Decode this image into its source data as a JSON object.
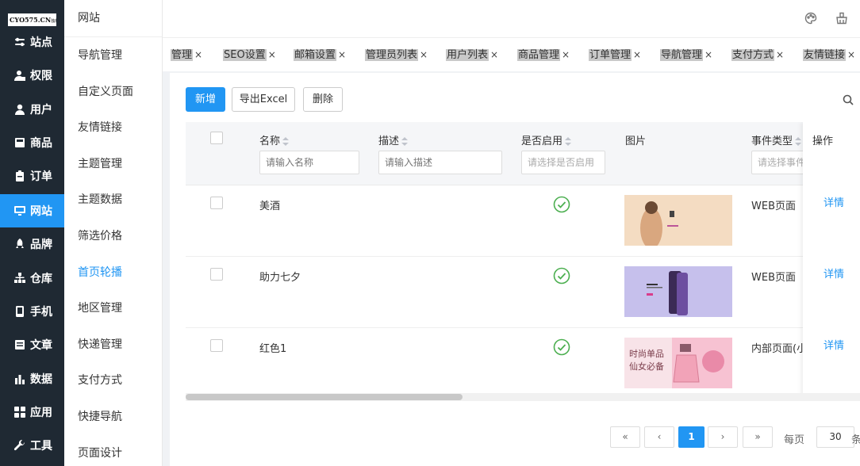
{
  "logo": {
    "text": "CYO575.CN",
    "sub": "独推"
  },
  "sidebar": {
    "items": [
      {
        "label": "站点",
        "icon": "sliders-icon"
      },
      {
        "label": "权限",
        "icon": "user-lock-icon"
      },
      {
        "label": "用户",
        "icon": "user-icon"
      },
      {
        "label": "商品",
        "icon": "box-icon"
      },
      {
        "label": "订单",
        "icon": "clipboard-icon"
      },
      {
        "label": "网站",
        "icon": "monitor-icon",
        "active": true
      },
      {
        "label": "品牌",
        "icon": "rocket-icon"
      },
      {
        "label": "仓库",
        "icon": "sitemap-icon"
      },
      {
        "label": "手机",
        "icon": "phone-icon"
      },
      {
        "label": "文章",
        "icon": "article-icon"
      },
      {
        "label": "数据",
        "icon": "bar-chart-icon"
      },
      {
        "label": "应用",
        "icon": "apps-icon"
      },
      {
        "label": "工具",
        "icon": "wrench-icon"
      }
    ]
  },
  "submenu": {
    "title": "网站",
    "items": [
      "导航管理",
      "自定义页面",
      "友情链接",
      "主题管理",
      "主题数据",
      "筛选价格",
      "首页轮播",
      "地区管理",
      "快递管理",
      "支付方式",
      "快捷导航",
      "页面设计"
    ],
    "active_index": 6
  },
  "tabs": [
    "管理",
    "SEO设置",
    "邮箱设置",
    "管理员列表",
    "用户列表",
    "商品管理",
    "订单管理",
    "导航管理",
    "支付方式",
    "友情链接"
  ],
  "tab_close": "×",
  "toolbar": {
    "add": "新增",
    "export": "导出Excel",
    "delete": "删除"
  },
  "table": {
    "columns": {
      "name": "名称",
      "desc": "描述",
      "enabled": "是否启用",
      "image": "图片",
      "event": "事件类型",
      "ops": "操作"
    },
    "filters": {
      "name": "请输入名称",
      "desc": "请输入描述",
      "enabled": "请选择是否启用",
      "event": "请选择事件"
    },
    "rows": [
      {
        "name": "美酒",
        "desc": "",
        "enabled": true,
        "event": "WEB页面",
        "action": "详情",
        "image": "wine-banner"
      },
      {
        "name": "助力七夕",
        "desc": "",
        "enabled": true,
        "event": "WEB页面",
        "action": "详情",
        "image": "phone-banner"
      },
      {
        "name": "红色1",
        "desc": "",
        "enabled": true,
        "event": "内部页面(小",
        "action": "详情",
        "image": "perfume-banner"
      }
    ]
  },
  "banner3": {
    "line1": "时尚单品",
    "line2": "仙女必备"
  },
  "pagination": {
    "first": "«",
    "prev": "‹",
    "current": "1",
    "next": "›",
    "last": "»",
    "per_page_label": "每页",
    "per_page": "30",
    "unit": "条"
  },
  "colors": {
    "accent": "#2196f3",
    "sidebar_bg": "#1f2933",
    "success": "#4caf50"
  }
}
